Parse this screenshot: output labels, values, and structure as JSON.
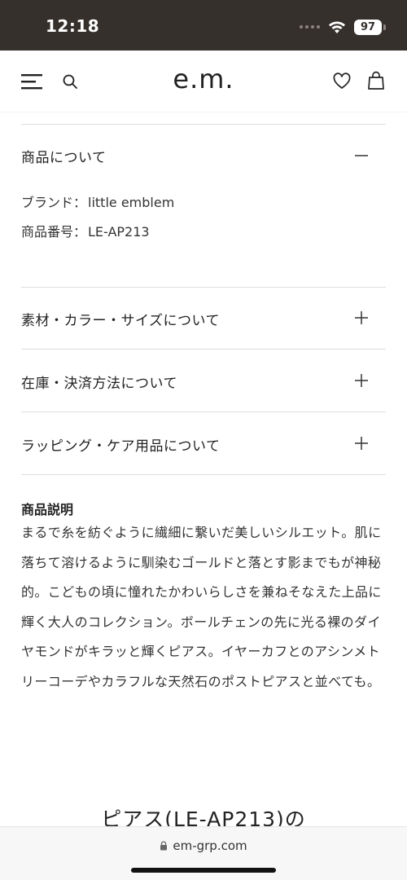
{
  "status_bar": {
    "time": "12:18",
    "battery": "97"
  },
  "header": {
    "logo": "e.m.",
    "icons": [
      "menu-icon",
      "search-icon",
      "heart-icon",
      "bag-icon"
    ]
  },
  "accordion": {
    "about_product": {
      "title": "商品について",
      "expanded": true,
      "brand_label": "ブランド：",
      "brand_value": "little emblem",
      "number_label": "商品番号：",
      "number_value": "LE-AP213"
    },
    "material": {
      "title": "素材・カラー・サイズについて",
      "expanded": false
    },
    "stock": {
      "title": "在庫・決済方法について",
      "expanded": false
    },
    "wrapping": {
      "title": "ラッピング・ケア用品について",
      "expanded": false
    }
  },
  "description": {
    "title": "商品説明",
    "body": "まるで糸を紡ぐように繊細に繋いだ美しいシルエット。肌に落ちて溶けるように馴染むゴールドと落とす影までもが神秘的。こどもの頃に憧れたかわいらしさを兼ねそなえた上品に輝く大人のコレクション。ボールチェンの先に光る裸のダイヤモンドがキラッと輝くピアス。イヤーカフとのアシンメトリーコーデやカラフルな天然石のポストピアスと並べても。"
  },
  "section_heading": "ピアス(LE-AP213)の",
  "browser": {
    "url": "em-grp.com"
  },
  "colors": {
    "status_bar_bg": "#36302d",
    "text": "#222222",
    "divider": "#dddddd"
  }
}
